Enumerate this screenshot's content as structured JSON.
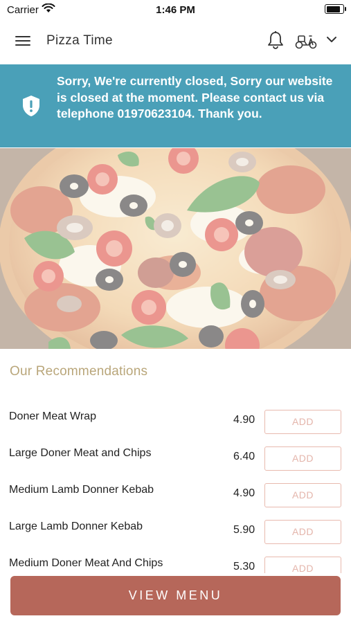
{
  "status_bar": {
    "carrier": "Carrier",
    "time": "1:46 PM",
    "battery_level": 0.95
  },
  "header": {
    "title": "Pizza Time",
    "icons": [
      "menu-icon",
      "bell-icon",
      "scooter-icon",
      "chevron-down-icon"
    ]
  },
  "banner": {
    "message": "Sorry, We're currently closed, Sorry our website is closed at the moment. Please contact us via telephone 01970623104. Thank you.",
    "icon": "shield-alert-icon",
    "color": "#4aa0b8"
  },
  "recommendations": {
    "title": "Our Recommendations",
    "add_label": "ADD",
    "items": [
      {
        "name": "Doner Meat Wrap",
        "price": "4.90"
      },
      {
        "name": "Large Doner Meat and Chips",
        "price": "6.40"
      },
      {
        "name": "Medium Lamb Donner Kebab",
        "price": "4.90"
      },
      {
        "name": "Large Lamb Donner Kebab",
        "price": "5.90"
      },
      {
        "name": "Medium Doner Meat And Chips",
        "price": "5.30"
      }
    ]
  },
  "footer": {
    "view_menu_label": "VIEW MENU",
    "accent_color": "#b6675a"
  }
}
